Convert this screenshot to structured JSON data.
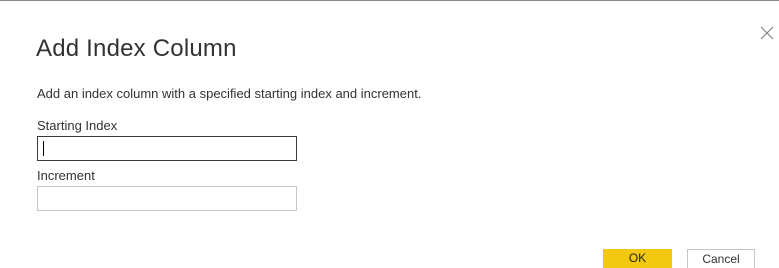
{
  "dialog": {
    "title": "Add Index Column",
    "description": "Add an index column with a specified starting index and increment.",
    "close_icon": "close-icon",
    "fields": {
      "starting_index": {
        "label": "Starting Index",
        "value": ""
      },
      "increment": {
        "label": "Increment",
        "value": ""
      }
    },
    "buttons": {
      "ok_label": "OK",
      "cancel_label": "Cancel"
    }
  },
  "colors": {
    "ok_button": "#f2c811",
    "input_border": "#c8c6c4",
    "focused_input_border": "#3b3a39",
    "text": "#333333"
  }
}
